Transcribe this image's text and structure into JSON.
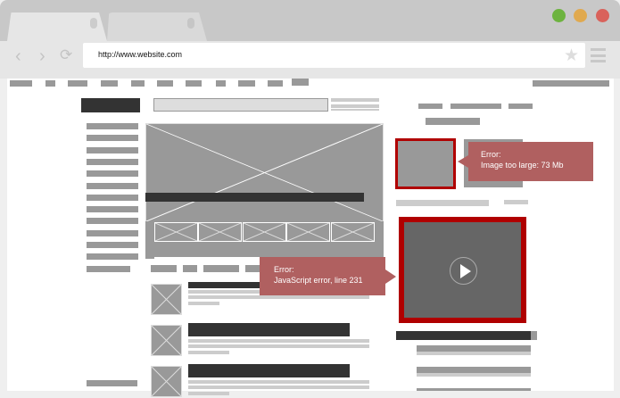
{
  "browser": {
    "url": "http://www.website.com",
    "window_controls": {
      "green": "#6db33f",
      "yellow": "#e0a94f",
      "red": "#d9625b"
    }
  },
  "errors": {
    "image": {
      "title": "Error:",
      "message": "Image too large: 73 Mb"
    },
    "script": {
      "title": "Error:",
      "message": "JavaScript error, line 231"
    }
  },
  "colors": {
    "error_border": "#b00000",
    "tooltip": "#b06060"
  }
}
